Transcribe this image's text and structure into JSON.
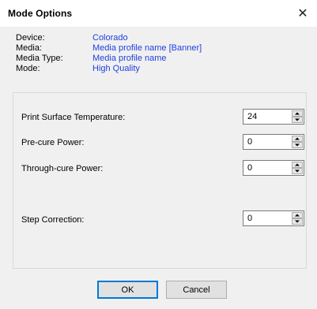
{
  "window": {
    "title": "Mode Options",
    "close_glyph": "✕"
  },
  "info": {
    "device_label": "Device:",
    "device_value": "Colorado",
    "media_label": "Media:",
    "media_value": "Media profile name [Banner]",
    "media_type_label": "Media Type:",
    "media_type_value": "Media profile name",
    "mode_label": "Mode:",
    "mode_value": "High Quality"
  },
  "fields": {
    "print_surface_temperature_label": "Print Surface Temperature:",
    "print_surface_temperature_value": "24",
    "pre_cure_power_label": "Pre-cure Power:",
    "pre_cure_power_value": "0",
    "through_cure_power_label": "Through-cure Power:",
    "through_cure_power_value": "0",
    "step_correction_label": "Step Correction:",
    "step_correction_value": "0"
  },
  "buttons": {
    "ok_label": "OK",
    "cancel_label": "Cancel"
  },
  "colors": {
    "link_blue": "#1f3fe0",
    "focus_border": "#0078d7"
  }
}
